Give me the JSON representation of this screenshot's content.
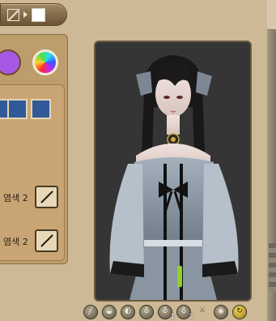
{
  "toolbar": {
    "items": [
      "eyedropper-icon",
      "arrow-right-icon",
      "white-swatch"
    ],
    "swatch_color": "#ffffff"
  },
  "palette": {
    "swatches": [
      {
        "name": "purple",
        "color": "#a758e6"
      },
      {
        "name": "rainbow-picker",
        "color": "rainbow"
      }
    ],
    "color_squares": [
      "#2f5a97",
      "#2f5a97",
      "#2f5a97"
    ]
  },
  "dye_slots": [
    {
      "label": "염색 2",
      "icon": "remove-dye-icon"
    },
    {
      "label": "염색 2",
      "icon": "remove-dye-icon"
    }
  ],
  "preview": {
    "background": "#353535"
  },
  "controls": [
    {
      "icon": "remove-icon",
      "num": ""
    },
    {
      "icon": "hat-icon",
      "num": ""
    },
    {
      "icon": "visor-icon",
      "num": ""
    },
    {
      "icon": "dye-bottle-icon",
      "num": ""
    },
    {
      "icon": "dye-bottle-icon",
      "num": "1"
    },
    {
      "icon": "dye-bottle-icon",
      "num": "2"
    },
    {
      "icon": "sheathe-icon",
      "num": ""
    },
    {
      "icon": "eye-icon",
      "num": ""
    },
    {
      "icon": "reset-icon",
      "num": ""
    }
  ]
}
